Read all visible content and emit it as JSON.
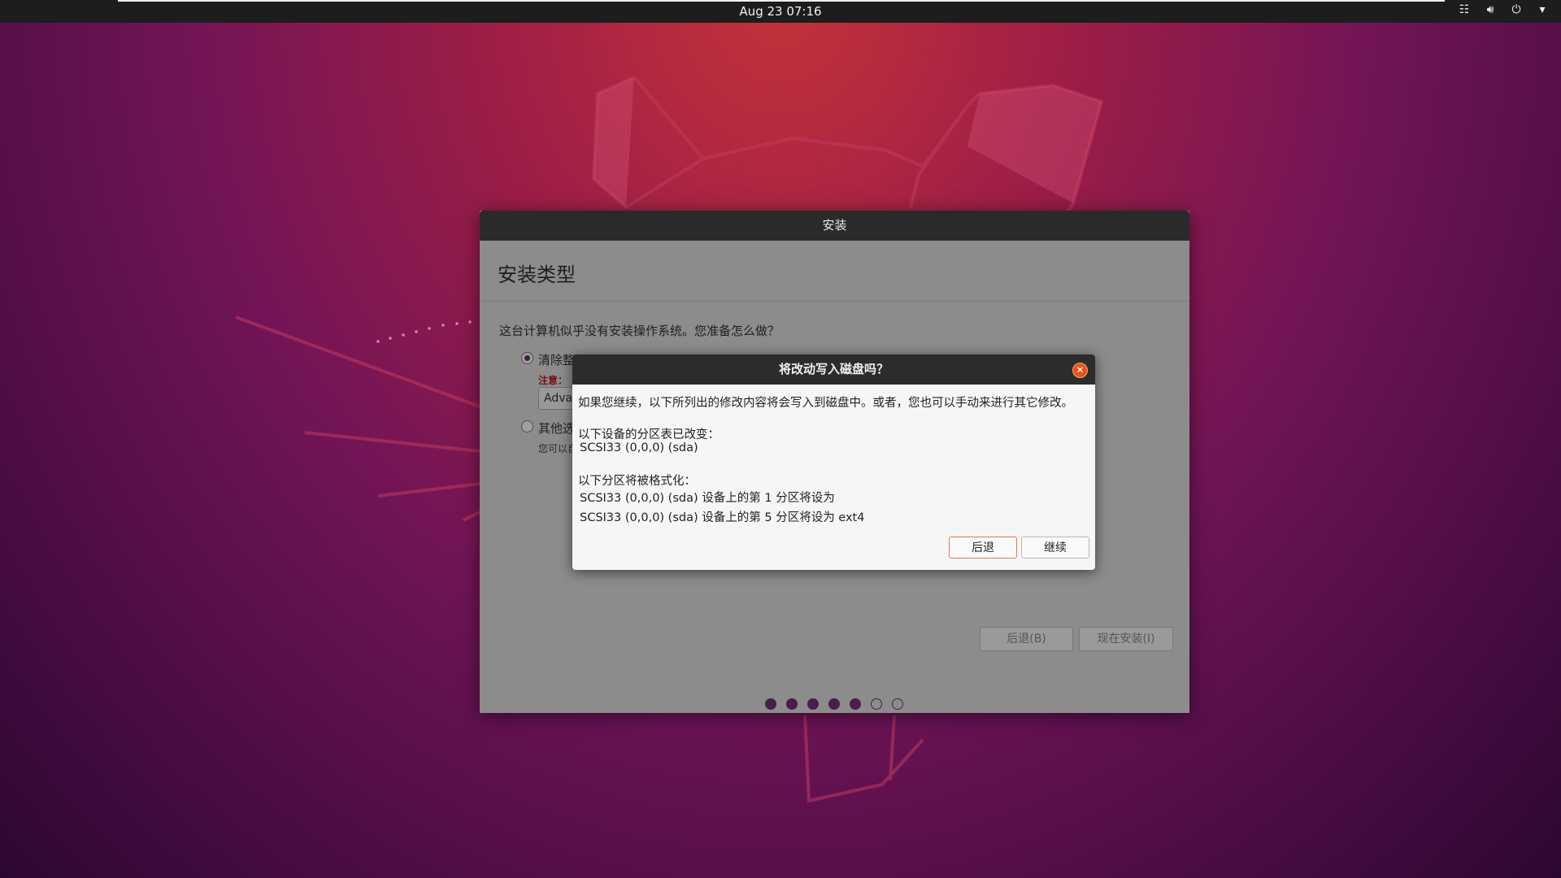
{
  "topbar": {
    "clock": "Aug 23  07:16",
    "tray_icons": [
      "network-icon",
      "volume-icon",
      "power-icon",
      "chevron-down-icon"
    ]
  },
  "installer": {
    "window_title": "安装",
    "page_heading": "安装类型",
    "question": "这台计算机似乎没有安装操作系统。您准备怎么做？",
    "option_erase": {
      "label": "清除整",
      "note": "注意：",
      "selected": true
    },
    "advanced_button": "Adva",
    "option_other": {
      "label": "其他选",
      "desc": "您可以自"
    },
    "back_button": "后退(B)",
    "install_now_button": "现在安装(I)",
    "progress": {
      "total_steps": 7,
      "completed_steps": 5
    }
  },
  "dialog": {
    "title": "将改动写入磁盘吗？",
    "intro": "如果您继续，以下所列出的修改内容将会写入到磁盘中。或者，您也可以手动来进行其它修改。",
    "partition_table_heading": "以下设备的分区表已改变：",
    "partition_table_device": "SCSI33 (0,0,0) (sda)",
    "format_heading": "以下分区将被格式化：",
    "format_lines": [
      "SCSI33 (0,0,0) (sda) 设备上的第 1 分区将设为",
      "SCSI33 (0,0,0) (sda) 设备上的第 5 分区将设为 ext4"
    ],
    "back_button": "后退",
    "continue_button": "继续",
    "close_icon": "close-icon"
  },
  "colors": {
    "accent": "#e5531c",
    "progress_dot": "#4a1e4a"
  }
}
